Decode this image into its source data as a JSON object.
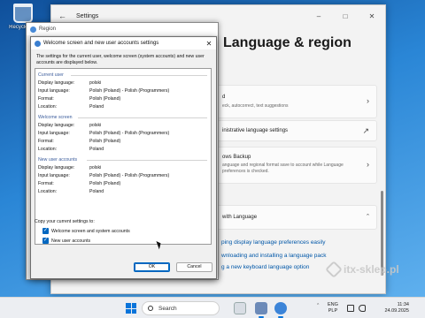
{
  "desktop": {
    "recycle_bin_label": "Recycle Bin"
  },
  "settings": {
    "window_title": "Settings",
    "back_icon": "arrow-left-icon",
    "heading": "Language & region",
    "cards": [
      {
        "title": "d",
        "subtitle": "eck, autocorrect, text suggestions"
      },
      {
        "title": "inistrative language settings"
      },
      {
        "title": "ows Backup",
        "subtitle": "anguage and regional format save to account while Language\npreferences is checked."
      },
      {
        "title": "with Language"
      }
    ],
    "links": [
      "ping display language preferences easily",
      "wnloading and installing a language pack",
      "g a new keyboard language option"
    ]
  },
  "region": {
    "title": "Region"
  },
  "dialog": {
    "title": "Welcome screen and new user accounts settings",
    "intro": "The settings for the current user, welcome screen (system accounts) and new user accounts are displayed below.",
    "groups": [
      {
        "name": "Current user",
        "rows": [
          {
            "label": "Display language:",
            "value": "polski"
          },
          {
            "label": "Input language:",
            "value": "Polish (Poland) - Polish (Programmers)"
          },
          {
            "label": "Format:",
            "value": "Polish (Poland)"
          },
          {
            "label": "Location:",
            "value": "Poland"
          }
        ]
      },
      {
        "name": "Welcome screen",
        "rows": [
          {
            "label": "Display language:",
            "value": "polski"
          },
          {
            "label": "Input language:",
            "value": "Polish (Poland) - Polish (Programmers)"
          },
          {
            "label": "Format:",
            "value": "Polish (Poland)"
          },
          {
            "label": "Location:",
            "value": "Poland"
          }
        ]
      },
      {
        "name": "New user accounts",
        "rows": [
          {
            "label": "Display language:",
            "value": "polski"
          },
          {
            "label": "Input language:",
            "value": "Polish (Poland) - Polish (Programmers)"
          },
          {
            "label": "Format:",
            "value": "Polish (Poland)"
          },
          {
            "label": "Location:",
            "value": "Poland"
          }
        ]
      }
    ],
    "copy_label": "Copy your current settings to:",
    "checkbox_welcome": {
      "label": "Welcome screen and system accounts",
      "checked": true
    },
    "checkbox_new_users": {
      "label": "New user accounts",
      "checked": true
    },
    "ok_label": "OK",
    "cancel_label": "Cancel"
  },
  "watermark": "itx-sklep.pl",
  "taskbar": {
    "search_placeholder": "Search",
    "lang_code": "ENG",
    "layout_code": "PLP",
    "time": "11:34",
    "date": "24.09.2025",
    "accent": "#0a74da"
  }
}
